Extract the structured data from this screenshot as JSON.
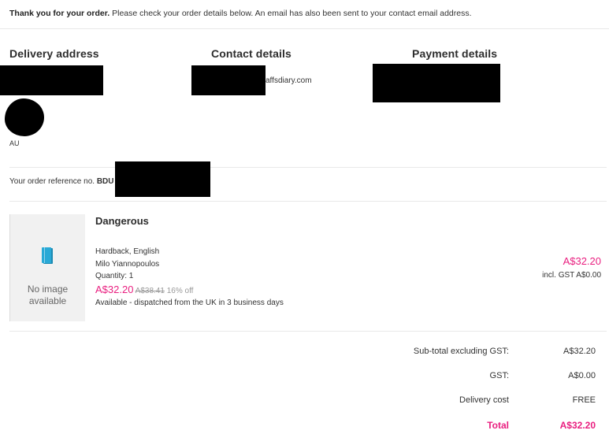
{
  "confirmation": {
    "bold": "Thank you for your order.",
    "rest": " Please check your order details below. An email has also been sent to your contact email address."
  },
  "columns": {
    "delivery_title": "Delivery address",
    "contact_title": "Contact details",
    "payment_title": "Payment details"
  },
  "delivery": {
    "country": "AU"
  },
  "contact": {
    "email_suffix": "affsdiary.com"
  },
  "order_ref": {
    "label": "Your order reference no.",
    "prefix": "BDU"
  },
  "product": {
    "title": "Dangerous",
    "format": "Hardback, English",
    "author": "Milo Yiannopoulos",
    "quantity": "Quantity: 1",
    "price": "A$32.20",
    "was_price": "A$38.41",
    "discount": "16% off",
    "availability": "Available - dispatched from the UK in 3 business days",
    "no_image_line1": "No image",
    "no_image_line2": "available",
    "icon": "book-icon",
    "line_price": "A$32.20",
    "incl_gst": "incl. GST A$0.00"
  },
  "summary": {
    "subtotal_label": "Sub-total excluding GST:",
    "subtotal_value": "A$32.20",
    "gst_label": "GST:",
    "gst_value": "A$0.00",
    "delivery_label": "Delivery cost",
    "delivery_value": "FREE",
    "total_label": "Total",
    "total_value": "A$32.20"
  },
  "colors": {
    "accent_pink": "#e91e7f",
    "book_icon": "#29a9d6"
  }
}
